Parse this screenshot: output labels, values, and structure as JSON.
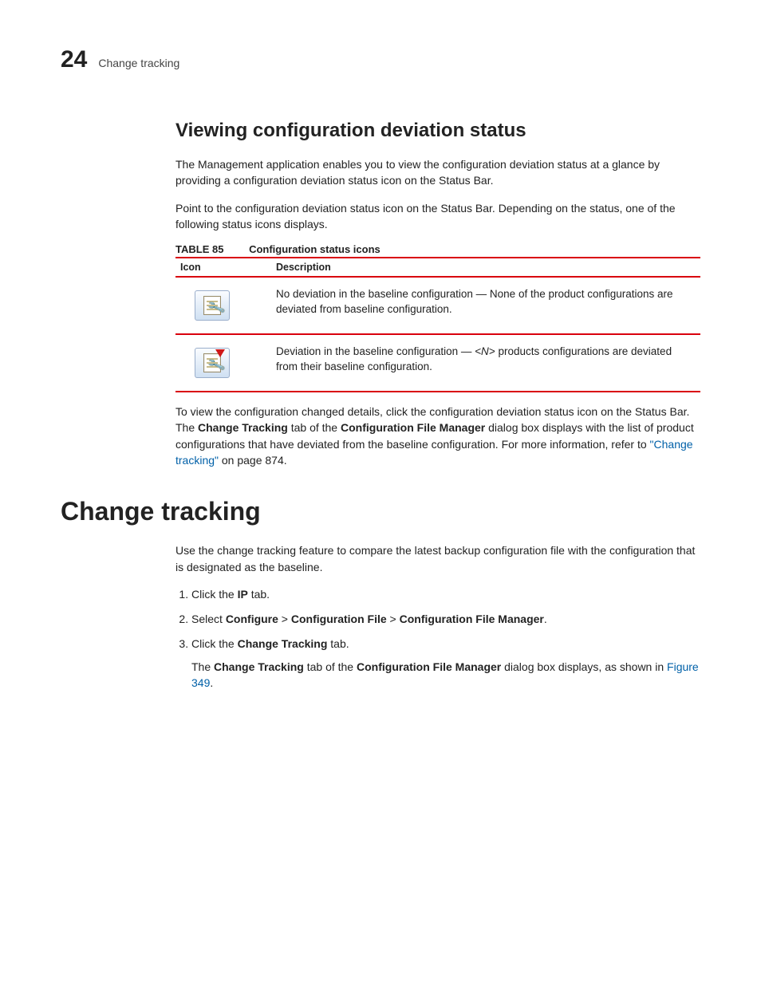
{
  "header": {
    "chapter_number": "24",
    "title": "Change tracking"
  },
  "section1": {
    "heading": "Viewing configuration deviation status",
    "p1": "The Management application enables you to view the configuration deviation status at a glance by providing a configuration deviation status icon on the Status Bar.",
    "p2": "Point to the configuration deviation status icon on the Status Bar. Depending on the status, one of the following status icons displays.",
    "table": {
      "label": "TABLE 85",
      "caption": "Configuration status icons",
      "col_icon": "Icon",
      "col_desc": "Description",
      "row1_desc": "No deviation in the baseline configuration — None of the product configurations are deviated from baseline configuration.",
      "row2_desc_a": "Deviation in the baseline configuration — ",
      "row2_desc_n": "<N>",
      "row2_desc_b": " products configurations are deviated from their baseline configuration."
    },
    "post": {
      "a": "To view the configuration changed details, click the configuration deviation status icon on the Status Bar. The ",
      "b1": "Change Tracking",
      "c": " tab of the ",
      "b2": "Configuration File Manager",
      "d": " dialog box displays with the list of product configurations that have deviated from the baseline configuration. For more information, refer to ",
      "link": "\"Change tracking\"",
      "e": " on page 874."
    }
  },
  "section2": {
    "heading": "Change tracking",
    "intro": "Use the change tracking feature to compare the latest backup configuration file with the configuration that is designated as the baseline.",
    "steps": {
      "s1a": "Click the ",
      "s1b": "IP",
      "s1c": " tab.",
      "s2a": "Select ",
      "s2b": "Configure",
      "s2c": " > ",
      "s2d": "Configuration File",
      "s2e": " > ",
      "s2f": "Configuration File Manager",
      "s2g": ".",
      "s3a": "Click the ",
      "s3b": "Change Tracking",
      "s3c": " tab.",
      "s3sub_a": "The ",
      "s3sub_b1": "Change Tracking",
      "s3sub_c": " tab of the ",
      "s3sub_b2": "Configuration File Manager",
      "s3sub_d": " dialog box displays, as shown in ",
      "s3sub_link": "Figure 349",
      "s3sub_e": "."
    }
  }
}
